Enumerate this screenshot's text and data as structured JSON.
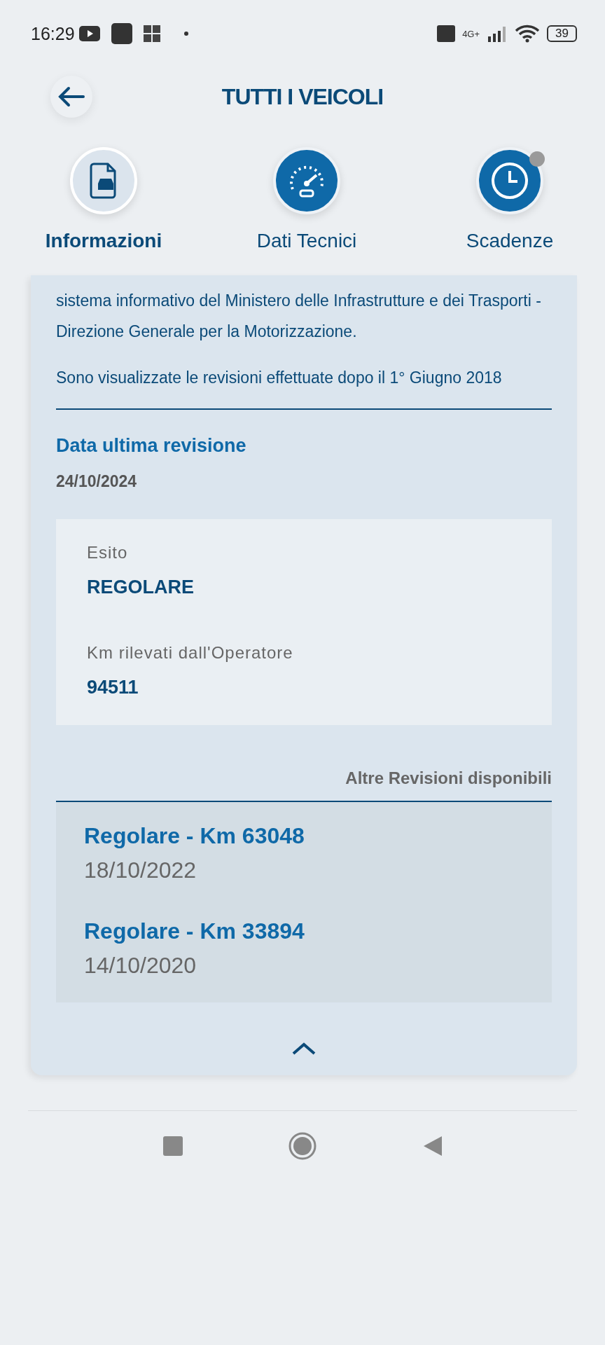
{
  "status_bar": {
    "time": "16:29",
    "battery": "39",
    "network": "4G+"
  },
  "header": {
    "title": "TUTTI I VEICOLI"
  },
  "tabs": [
    {
      "label": "Informazioni",
      "kind": "info",
      "selected": true,
      "badge": false
    },
    {
      "label": "Dati Tecnici",
      "kind": "tech",
      "selected": false,
      "badge": false
    },
    {
      "label": "Scadenze",
      "kind": "deadline",
      "selected": false,
      "badge": true
    }
  ],
  "intro": [
    "sistema informativo del Ministero delle Infrastrutture e dei Trasporti - Direzione Generale per la Motorizzazione.",
    "Sono visualizzate le revisioni effettuate dopo il 1° Giugno 2018"
  ],
  "last_revision": {
    "label": "Data ultima revisione",
    "date": "24/10/2024"
  },
  "details": [
    {
      "label": "Esito",
      "value": "REGOLARE"
    },
    {
      "label": "Km rilevati dall'Operatore",
      "value": "94511"
    }
  ],
  "other_revisions": {
    "title": "Altre Revisioni disponibili",
    "items": [
      {
        "title": "Regolare - Km 63048",
        "date": "18/10/2022"
      },
      {
        "title": "Regolare - Km 33894",
        "date": "14/10/2020"
      }
    ]
  }
}
